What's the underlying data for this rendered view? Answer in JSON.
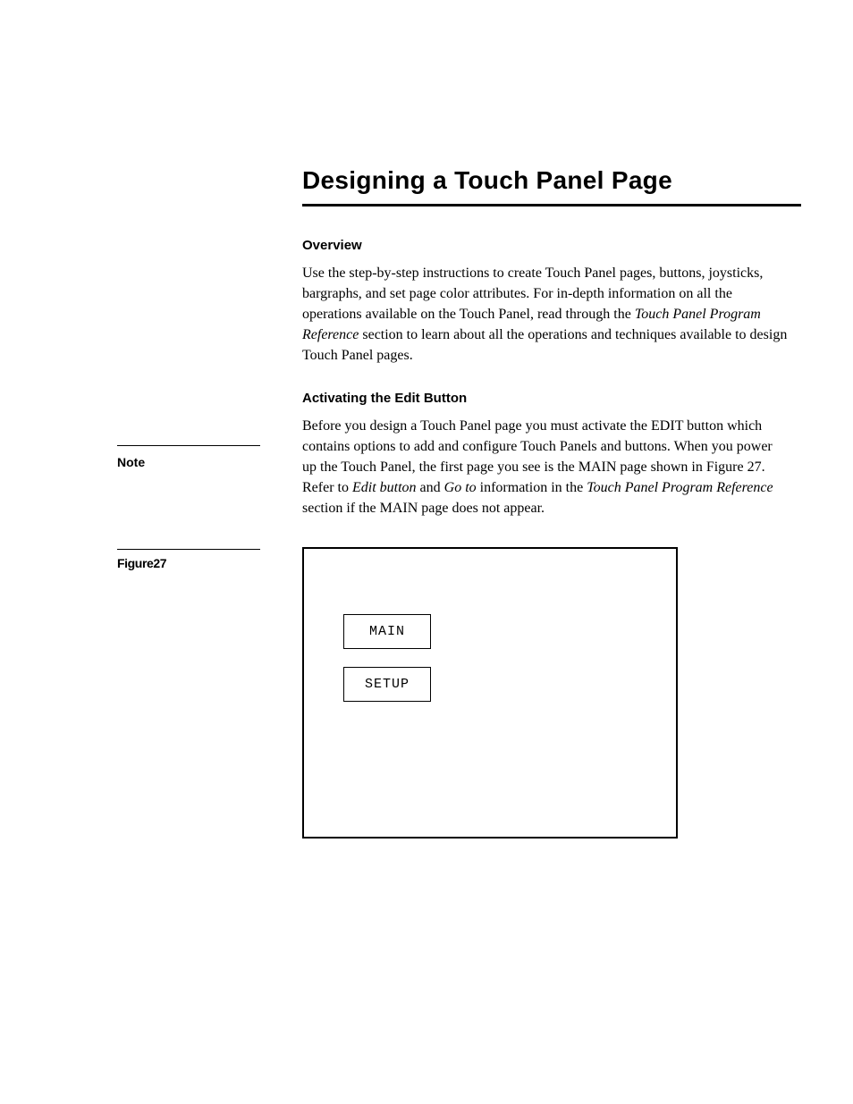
{
  "title": "Designing a Touch Panel Page",
  "overview": {
    "heading": "Overview",
    "p1a": "Use the step-by-step instructions to create Touch Panel pages, buttons, joysticks, bargraphs, and set page color attributes. For in-depth information on all the operations available on the Touch Panel, read through the ",
    "p1b": "Touch Panel Program Reference",
    "p1c": " section to learn about all the operations and techniques available to design Touch Panel pages."
  },
  "activating": {
    "heading": "Activating the Edit Button",
    "p1a": "Before you design a Touch Panel page you must activate the EDIT button which contains options to add and configure Touch Panels and buttons. When you power up the Touch Panel, the first page you see is the MAIN page shown in Figure 27. Refer to ",
    "p1b": "Edit button",
    "p1c": " and ",
    "p1d": "Go to",
    "p1e": " information in the ",
    "p1f": "Touch Panel Program Reference",
    "p1g": " section if the MAIN page does not appear."
  },
  "sidebar": {
    "note": "Note",
    "figure": "Figure27"
  },
  "figure_buttons": {
    "main": "MAIN",
    "setup": "SETUP"
  }
}
